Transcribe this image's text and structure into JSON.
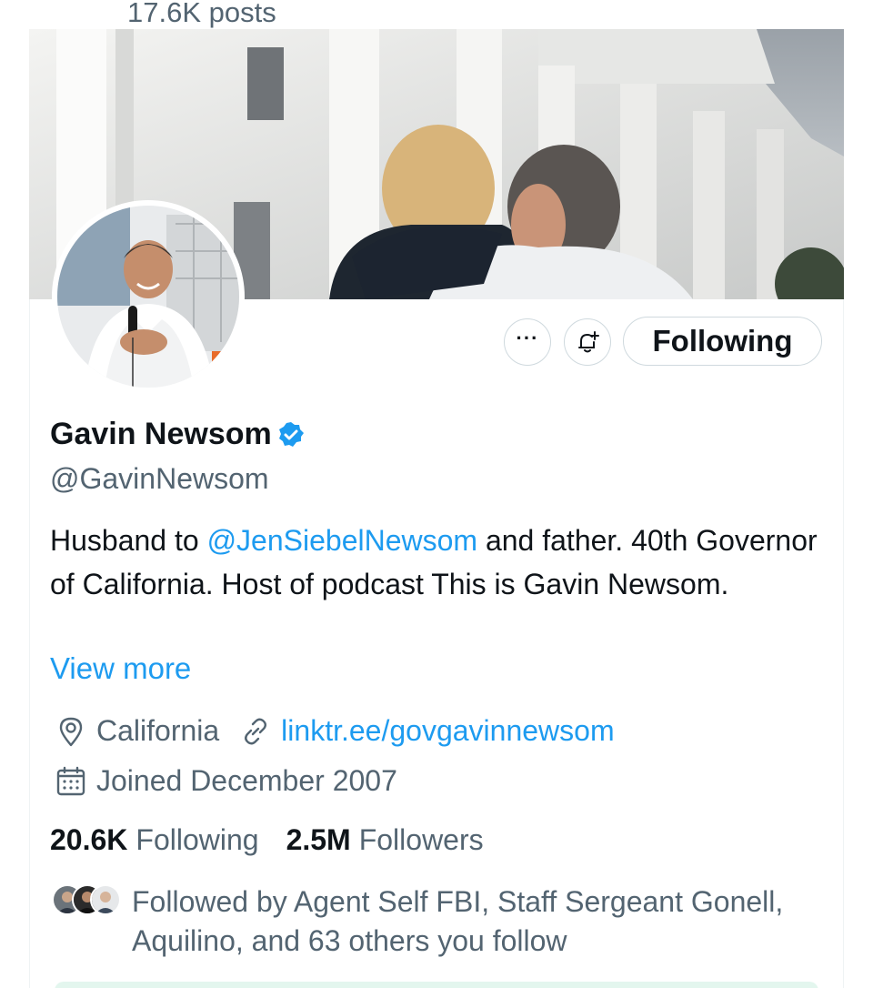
{
  "header": {
    "post_count": "17.6K posts"
  },
  "profile": {
    "name": "Gavin Newsom",
    "handle": "@GavinNewsom",
    "bio": {
      "prefix": "Husband to ",
      "mention": "@JenSiebelNewsom",
      "suffix": " and father. 40th Governor of California. Host of podcast This is Gavin Newsom."
    },
    "view_more": "View more",
    "location": "California",
    "website": "linktr.ee/govgavinnewsom",
    "joined": "Joined December 2007",
    "following_count": "20.6K",
    "following_label": "Following",
    "followers_count": "2.5M",
    "followers_label": "Followers",
    "followed_by": "Followed by Agent Self FBI, Staff Sergeant Gonell, Aquilino, and 63 others you follow"
  },
  "actions": {
    "more_label": "···",
    "following_button": "Following"
  },
  "icons": {
    "more": "more-icon",
    "notify": "bell-plus-icon",
    "verified": "verified-badge-icon",
    "location": "location-pin-icon",
    "link": "link-icon",
    "calendar": "calendar-icon"
  },
  "colors": {
    "accent": "#1d9bf0",
    "text_primary": "#0f1419",
    "text_secondary": "#536471",
    "border": "#cfd9de"
  }
}
